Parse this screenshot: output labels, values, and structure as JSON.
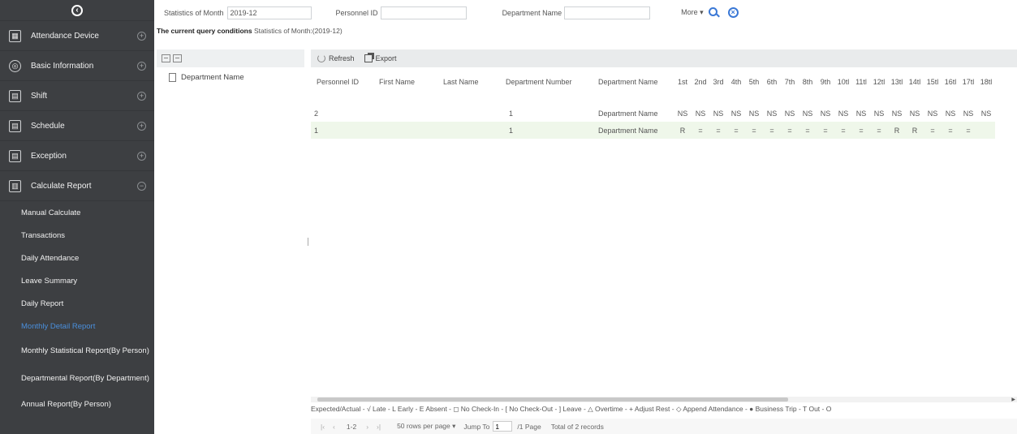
{
  "sidebar": {
    "collapse_glyph": "‹",
    "menus": [
      {
        "label": "Attendance Device",
        "icon": "device-icon",
        "state": "+"
      },
      {
        "label": "Basic Information",
        "icon": "info-icon",
        "state": "+"
      },
      {
        "label": "Shift",
        "icon": "shift-icon",
        "state": "+"
      },
      {
        "label": "Schedule",
        "icon": "schedule-icon",
        "state": "+"
      },
      {
        "label": "Exception",
        "icon": "exception-icon",
        "state": "+"
      },
      {
        "label": "Calculate Report",
        "icon": "report-icon",
        "state": "−"
      }
    ],
    "submenu": [
      "Manual Calculate",
      "Transactions",
      "Daily Attendance",
      "Leave Summary",
      "Daily Report",
      "Monthly Detail Report",
      "Monthly Statistical Report(By Person)",
      "Departmental Report(By Department)",
      "Annual Report(By Person)"
    ],
    "active_submenu": "Monthly Detail Report"
  },
  "search": {
    "month_label": "Statistics of Month",
    "month_value": "2019-12",
    "personnel_label": "Personnel ID",
    "personnel_value": "",
    "department_label": "Department Name",
    "department_value": "",
    "more_label": "More ▾"
  },
  "query": {
    "bold": "The current query conditions",
    "text": "Statistics of Month:(2019-12)"
  },
  "tree": {
    "root": "Department Name"
  },
  "toolbar": {
    "refresh": "Refresh",
    "export": "Export"
  },
  "table": {
    "columns": [
      "Personnel ID",
      "First Name",
      "Last Name",
      "Department Number",
      "Department Name"
    ],
    "days": [
      "1st",
      "2nd",
      "3rd",
      "4th",
      "5th",
      "6th",
      "7th",
      "8th",
      "9th",
      "10tl",
      "11tl",
      "12tl",
      "13tl",
      "14tl",
      "15tl",
      "16tl",
      "17tl",
      "18tl"
    ],
    "rows": [
      {
        "cells": [
          "2",
          "",
          "",
          "1",
          "Department Name"
        ],
        "days": [
          "NS",
          "NS",
          "NS",
          "NS",
          "NS",
          "NS",
          "NS",
          "NS",
          "NS",
          "NS",
          "NS",
          "NS",
          "NS",
          "NS",
          "NS",
          "NS",
          "NS",
          "NS"
        ]
      },
      {
        "cells": [
          "1",
          "",
          "",
          "1",
          "Department Name"
        ],
        "days": [
          "R",
          "=",
          "=",
          "=",
          "=",
          "=",
          "=",
          "=",
          "=",
          "=",
          "=",
          "=",
          "R",
          "R",
          "=",
          "=",
          "="
        ]
      }
    ]
  },
  "legend": "Expected/Actual - √  Late - L  Early - E  Absent - ◻  No Check-In - [  No Check-Out - ]  Leave - △  Overtime - +  Adjust Rest - ◇  Append Attendance - ●  Business Trip - T  Out - O",
  "pager": {
    "first": "|‹",
    "prev": "‹",
    "range": "1-2",
    "next": "›",
    "last": "›|",
    "per_page": "50 rows per page  ▾",
    "jump_label": "Jump To",
    "jump_value": "1",
    "page_total": "/1 Page",
    "records": "Total of 2 records"
  }
}
